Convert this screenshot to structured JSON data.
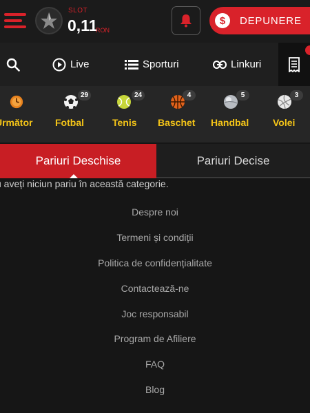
{
  "header": {
    "slot_label": "SLOT",
    "balance": "0,11",
    "currency": "RON",
    "deposit_label": "DEPUNERE",
    "accent_color": "#d9222a"
  },
  "nav": {
    "items": [
      {
        "label": "",
        "icon": "search-icon"
      },
      {
        "label": "Live",
        "icon": "play-circle-icon"
      },
      {
        "label": "Sporturi",
        "icon": "list-icon"
      },
      {
        "label": "Linkuri",
        "icon": "link-icon"
      },
      {
        "label": "",
        "icon": "betslip-icon"
      }
    ]
  },
  "sports": [
    {
      "name": "Următor",
      "count": "",
      "icon": "clock-icon"
    },
    {
      "name": "Fotbal",
      "count": "29",
      "icon": "football-icon"
    },
    {
      "name": "Tenis",
      "count": "24",
      "icon": "tennis-ball-icon"
    },
    {
      "name": "Baschet",
      "count": "4",
      "icon": "basketball-icon"
    },
    {
      "name": "Handbal",
      "count": "5",
      "icon": "handball-icon"
    },
    {
      "name": "Volei",
      "count": "3",
      "icon": "volleyball-icon"
    }
  ],
  "tabs": {
    "open": "Pariuri Deschise",
    "settled": "Pariuri Decise"
  },
  "empty_message": "u aveți niciun pariu în această categorie.",
  "footer": {
    "links": [
      "Despre noi",
      "Termeni și condiții",
      "Politica de confidențialitate",
      "Contactează-ne",
      "Joc responsabil",
      "Program de Afiliere",
      "FAQ",
      "Blog"
    ]
  }
}
